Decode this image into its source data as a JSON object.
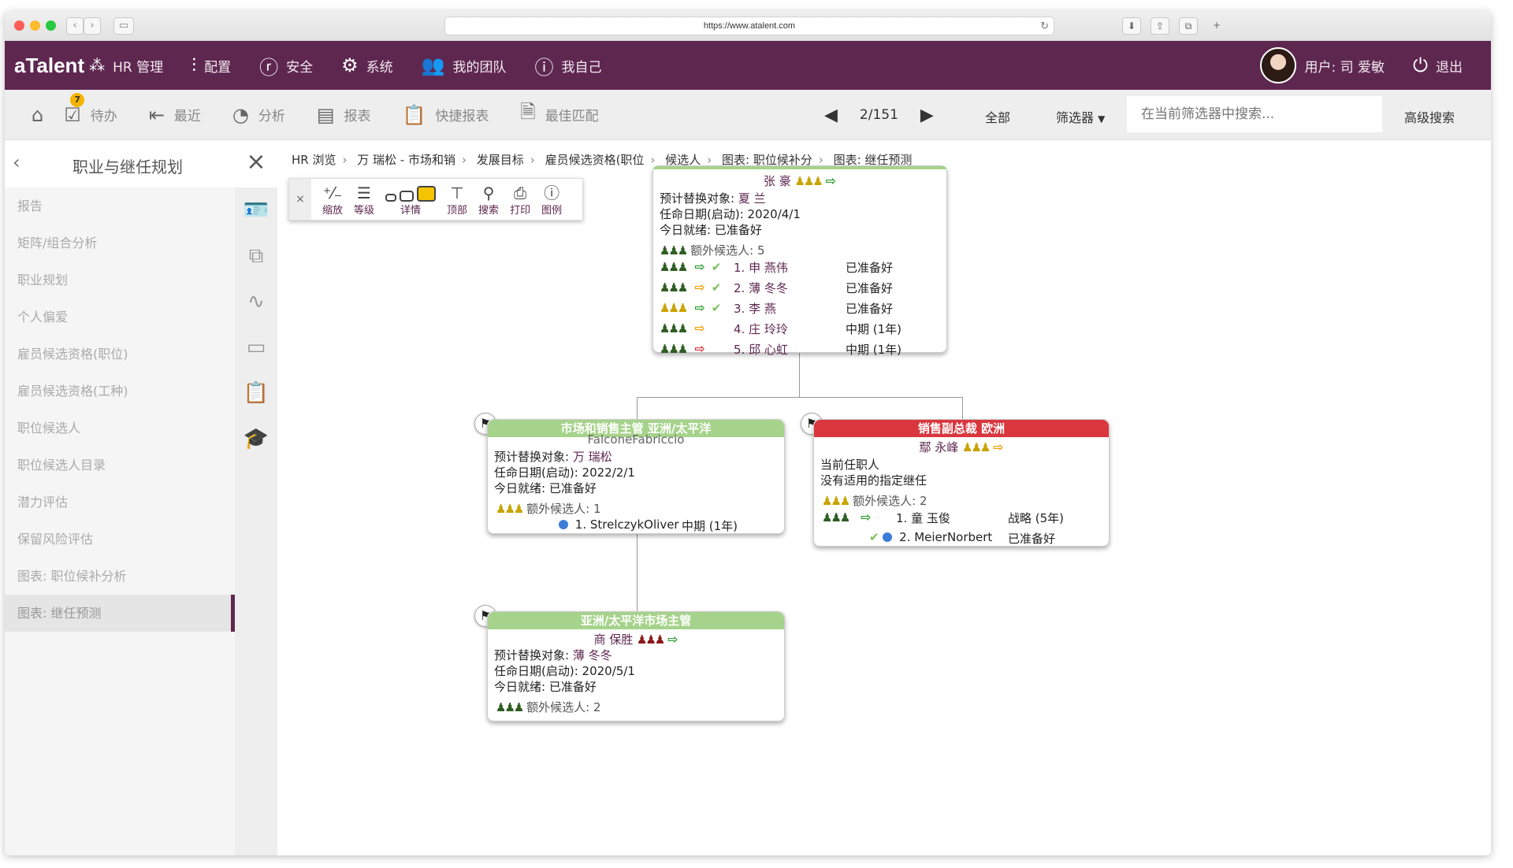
{
  "browser": {
    "url": "https://www.atalent.com"
  },
  "nav": {
    "logo": "aTalent",
    "items": [
      {
        "label": "HR 管理",
        "icon": "sparkle-icon"
      },
      {
        "label": "配置",
        "icon": "sliders-icon"
      },
      {
        "label": "安全",
        "icon": "security-icon"
      },
      {
        "label": "系统",
        "icon": "gear-icon"
      },
      {
        "label": "我的团队",
        "icon": "team-icon"
      },
      {
        "label": "我自己",
        "icon": "user-icon"
      }
    ],
    "user_label": "用户: 司 爱敏",
    "logout_label": "退出"
  },
  "toolbar": {
    "todo_label": "待办",
    "todo_badge": "7",
    "recent_label": "最近",
    "analysis_label": "分析",
    "reports_label": "报表",
    "quick_reports_label": "快捷报表",
    "best_match_label": "最佳匹配",
    "pager": "2/151",
    "all_label": "全部",
    "filter_label": "筛选器",
    "search_placeholder": "在当前筛选器中搜索...",
    "advanced_search_label": "高级搜索"
  },
  "sidebar": {
    "title": "职业与继任规划",
    "items": [
      {
        "label": "报告"
      },
      {
        "label": "矩阵/组合分析"
      },
      {
        "label": "职业规划"
      },
      {
        "label": "个人偏爱"
      },
      {
        "label": "雇员候选资格(职位)"
      },
      {
        "label": "雇员候选资格(工种)"
      },
      {
        "label": "职位候选人"
      },
      {
        "label": "职位候选人目录"
      },
      {
        "label": "潜力评估"
      },
      {
        "label": "保留风险评估"
      },
      {
        "label": "图表: 职位候补分析"
      },
      {
        "label": "图表: 继任预测"
      }
    ],
    "active_index": 11
  },
  "breadcrumb": [
    "HR 浏览",
    "万 瑞松 - 市场和销",
    "发展目标",
    "雇员候选资格(职位",
    "候选人",
    "图表: 职位候补分",
    "图表: 继任预测"
  ],
  "chart_tools": {
    "close": "×",
    "zoom": "缩放",
    "level": "等级",
    "detail": "详情",
    "top": "顶部",
    "search": "搜索",
    "print": "打印",
    "legend": "图例"
  },
  "cards": {
    "top": {
      "name": "张 豪",
      "replace_label": "预计替换对象:",
      "replace_name": "夏 兰",
      "date": "任命日期(启动): 2020/4/1",
      "ready": "今日就绪: 已准备好",
      "extra": "额外候选人: 5",
      "candidates": [
        {
          "name": "1. 申 燕伟",
          "status": "已准备好",
          "exit": "green",
          "check": true
        },
        {
          "name": "2. 薄 冬冬",
          "status": "已准备好",
          "exit": "orange",
          "check": true
        },
        {
          "name": "3. 李 燕",
          "status": "已准备好",
          "exit": "green",
          "check": true
        },
        {
          "name": "4. 庄 玲玲",
          "status": "中期 (1年)",
          "exit": "orange",
          "check": false
        },
        {
          "name": "5. 邱 心虹",
          "status": "中期 (1年)",
          "exit": "red",
          "check": false
        }
      ]
    },
    "left": {
      "title": "市场和销售主管 亚洲/太平洋",
      "subtitle": "FalconeFabriccio",
      "replace_label": "预计替换对象:",
      "replace_name": "万 瑞松",
      "date": "任命日期(启动): 2022/2/1",
      "ready": "今日就绪: 已准备好",
      "extra": "额外候选人: 1",
      "candidate_name": "1. StrelczykOliver",
      "candidate_status": "中期 (1年)"
    },
    "right": {
      "title": "销售副总裁 欧洲",
      "name": "鄢 永峰",
      "incumbent": "当前任职人",
      "no_successor": "没有适用的指定继任",
      "extra": "额外候选人: 2",
      "c1_name": "1. 童 玉俊",
      "c1_status": "战略 (5年)",
      "c2_name": "2. MeierNorbert",
      "c2_status": "已准备好"
    },
    "bottom": {
      "title": "亚洲/太平洋市场主管",
      "name": "商 保胜",
      "replace_label": "预计替换对象:",
      "replace_name": "薄 冬冬",
      "date": "任命日期(启动): 2020/5/1",
      "ready": "今日就绪: 已准备好",
      "extra": "额外候选人: 2"
    }
  },
  "colors": {
    "brand": "#5e2750",
    "green_header": "#a6d38b",
    "red_header": "#d9363e"
  }
}
